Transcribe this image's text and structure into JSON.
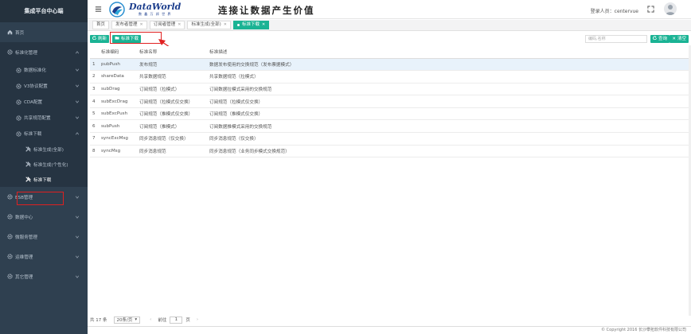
{
  "sidebar": {
    "title": "集成平台中心端",
    "items": [
      {
        "label": "首页",
        "icon": "home-icon"
      },
      {
        "label": "标准化管理",
        "icon": "gear-icon"
      },
      {
        "label": "数据标准化",
        "icon": "gear-icon"
      },
      {
        "label": "V3协议配置",
        "icon": "gear-icon"
      },
      {
        "label": "CDA配置",
        "icon": "gear-icon"
      },
      {
        "label": "共享规范配置",
        "icon": "gear-icon"
      },
      {
        "label": "标准下载",
        "icon": "gear-icon"
      },
      {
        "label": "标准生成(全部)",
        "icon": "tools-icon"
      },
      {
        "label": "标准生成(个性化)",
        "icon": "tools-icon"
      },
      {
        "label": "标准下载",
        "icon": "tools-icon"
      },
      {
        "label": "ESB管理",
        "icon": "gear-icon"
      },
      {
        "label": "数据中心",
        "icon": "gear-icon"
      },
      {
        "label": "微服务管理",
        "icon": "gear-icon"
      },
      {
        "label": "运维管理",
        "icon": "gear-icon"
      },
      {
        "label": "其它管理",
        "icon": "gear-icon"
      }
    ]
  },
  "header": {
    "logo_main": "DataWorld",
    "logo_sub": "数 鑫 万 邦 世 界",
    "slogan": "连接让数据产生价值",
    "login_text": "登录人员：centervue"
  },
  "tabs": [
    {
      "label": "首页",
      "closable": false
    },
    {
      "label": "发布者管理",
      "closable": true
    },
    {
      "label": "订阅者管理",
      "closable": true
    },
    {
      "label": "标准生成(全部)",
      "closable": true
    },
    {
      "label": "标准下载",
      "closable": true
    }
  ],
  "toolbar": {
    "refresh_label": "刷新",
    "download_label": "标准下载",
    "search_placeholder": "编码,名称",
    "query_label": "查询",
    "reset_label": "清空"
  },
  "table": {
    "columns": [
      "",
      "标准编码",
      "标准名称",
      "标准描述"
    ],
    "rows": [
      [
        "1",
        "pubPush",
        "发布规范",
        "数据发布使用的交换规范（发布票据模式）"
      ],
      [
        "2",
        "shareData",
        "共享数据规范",
        "共享数据规范（拉模式）"
      ],
      [
        "3",
        "subDrag",
        "订阅规范（拉模式）",
        "订阅数据拉模式采用的交换规范"
      ],
      [
        "4",
        "subExcDrag",
        "订阅规范（拉模式仅交换）",
        "订阅规范（拉模式仅交换）"
      ],
      [
        "5",
        "subExcPush",
        "订阅规范（推模式仅交换）",
        "订阅规范（推模式仅交换）"
      ],
      [
        "6",
        "subPush",
        "订阅规范（推模式）",
        "订阅数据推模式采用的交换规范"
      ],
      [
        "7",
        "syncExcMsg",
        "同步消息规范（仅交换）",
        "同步消息规范（仅交换）"
      ],
      [
        "8",
        "syncMsg",
        "同步消息规范",
        "同步消息规范（业务同步模式交换规范）"
      ]
    ]
  },
  "pager": {
    "total": "共 17 条",
    "page_size": "20条/页",
    "goto_label": "前往",
    "page": "1",
    "page_suffix": "页"
  },
  "footer": "© Copyright 2016 长沙攀拓软件科技有限公司"
}
